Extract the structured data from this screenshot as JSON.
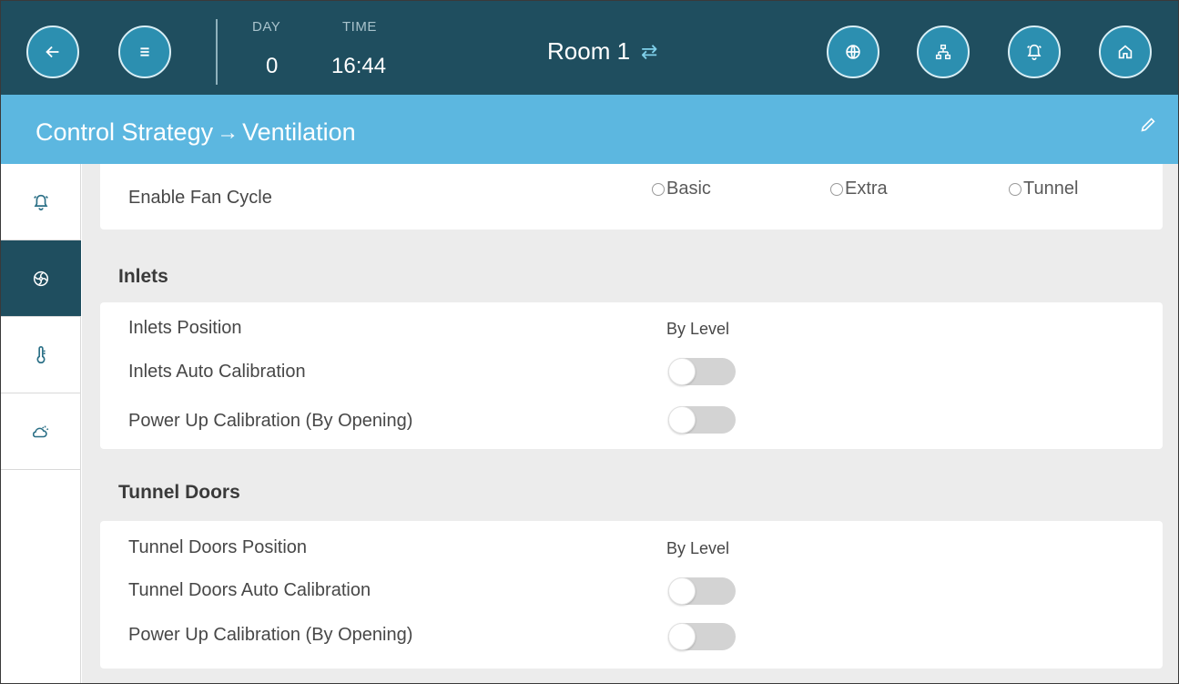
{
  "header": {
    "day_label": "DAY",
    "day_value": "0",
    "time_label": "TIME",
    "time_value": "16:44",
    "room": "Room 1",
    "room_swap_icon": "⇄"
  },
  "breadcrumb": {
    "parent": "Control Strategy",
    "separator": "→",
    "current": "Ventilation"
  },
  "sidebar": {
    "items": [
      {
        "icon": "alarm-bell-icon",
        "active": false
      },
      {
        "icon": "fan-icon",
        "active": true
      },
      {
        "icon": "thermometer-icon",
        "active": false
      },
      {
        "icon": "cloud-sun-icon",
        "active": false
      }
    ]
  },
  "fan_cycle": {
    "label": "Enable Fan Cycle",
    "options": [
      "Basic",
      "Extra",
      "Tunnel"
    ]
  },
  "inlets": {
    "title": "Inlets",
    "position_label": "Inlets Position",
    "position_value": "By Level",
    "auto_cal_label": "Inlets Auto Calibration",
    "auto_cal_on": false,
    "power_up_label": "Power Up Calibration (By Opening)",
    "power_up_on": false
  },
  "tunnel_doors": {
    "title": "Tunnel Doors",
    "position_label": "Tunnel Doors Position",
    "position_value": "By Level",
    "auto_cal_label": "Tunnel Doors Auto Calibration",
    "auto_cal_on": false,
    "power_up_label": "Power Up Calibration (By Opening)",
    "power_up_on": false
  },
  "colors": {
    "header_bg": "#1f4e5f",
    "breadcrumb_bg": "#5cb7e0",
    "button_bg": "#2c8fb0",
    "content_bg": "#ececec"
  }
}
